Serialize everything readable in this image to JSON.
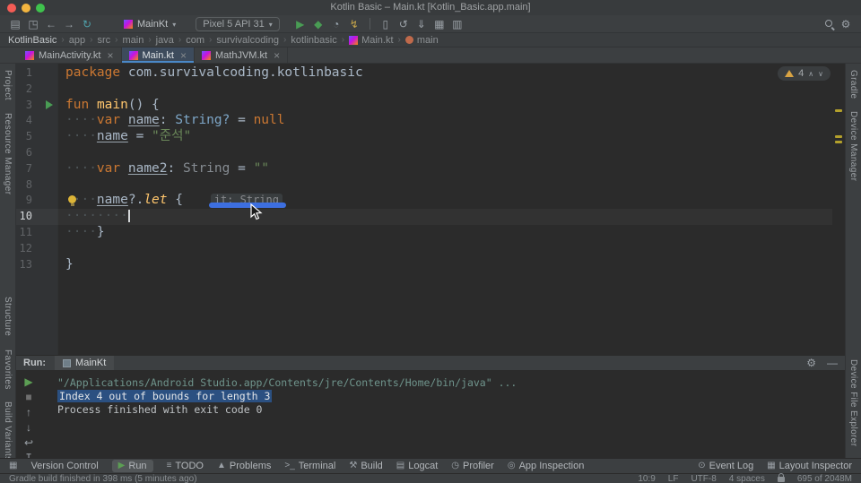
{
  "window": {
    "title": "Kotlin Basic – Main.kt [Kotlin_Basic.app.main]"
  },
  "toolbar": {
    "left_icons": [
      {
        "name": "save-all-icon",
        "glyph": "▤"
      },
      {
        "name": "open-icon",
        "glyph": "◳"
      },
      {
        "name": "back-icon",
        "glyph": "←"
      },
      {
        "name": "forward-icon",
        "glyph": "→"
      },
      {
        "name": "refresh-icon",
        "glyph": "↻",
        "color": "#4e9fa8"
      }
    ],
    "run_config": {
      "label": "MainKt"
    },
    "device": {
      "label": "Pixel 5 API 31"
    },
    "action_icons": [
      {
        "name": "run-icon",
        "glyph": "▶",
        "color": "#499c54"
      },
      {
        "name": "debug-icon",
        "glyph": "◆",
        "color": "#499c54"
      },
      {
        "name": "profile-icon",
        "glyph": "◔",
        "color": "#9aa7b0"
      },
      {
        "name": "apply-changes-icon",
        "glyph": "↯",
        "color": "#c4a44a"
      },
      {
        "sep": true
      },
      {
        "name": "device-manager-icon",
        "glyph": "▯"
      },
      {
        "name": "sync-project-icon",
        "glyph": "↺"
      },
      {
        "name": "sdk-manager-icon",
        "glyph": "⇓"
      },
      {
        "name": "layout-inspector-icon",
        "glyph": "▦"
      },
      {
        "name": "logcat-icon",
        "glyph": "▥"
      }
    ],
    "right_icons": [
      {
        "name": "search-icon",
        "css": "search"
      },
      {
        "name": "settings-gear-icon",
        "glyph": "⚙"
      }
    ]
  },
  "breadcrumb": {
    "separator": "›",
    "items": [
      {
        "label": "KotlinBasic"
      },
      {
        "label": "app"
      },
      {
        "label": "src"
      },
      {
        "label": "main"
      },
      {
        "label": "java"
      },
      {
        "label": "com"
      },
      {
        "label": "survivalcoding"
      },
      {
        "label": "kotlinbasic"
      },
      {
        "label": "Main.kt",
        "icon": "kotlin"
      },
      {
        "label": "main",
        "icon": "function"
      }
    ]
  },
  "tabs": [
    {
      "label": "MainActivity.kt",
      "active": false
    },
    {
      "label": "Main.kt",
      "active": true
    },
    {
      "label": "MathJVM.kt",
      "active": false
    }
  ],
  "left_strip": {
    "top": [
      "Project",
      "Resource Manager"
    ],
    "middle": [
      "Structure",
      "Favorites"
    ],
    "bottom": [
      "Build Variants"
    ]
  },
  "right_strip": {
    "top": [
      "Gradle",
      "Device Manager"
    ],
    "bottom": [
      "Device File Explorer"
    ]
  },
  "editor": {
    "warnings": "4",
    "lines": [
      {
        "num": "1",
        "tokens": [
          {
            "t": "package",
            "c": "kw"
          },
          {
            "t": " com.survivalcoding.kotlinbasic",
            "c": "pl"
          }
        ]
      },
      {
        "num": "2",
        "tokens": []
      },
      {
        "num": "3",
        "gutter": "run",
        "tokens": [
          {
            "t": "fun",
            "c": "kw"
          },
          {
            "t": " ",
            "c": "pl"
          },
          {
            "t": "main",
            "c": "fn"
          },
          {
            "t": "() {",
            "c": "pl"
          }
        ]
      },
      {
        "num": "4",
        "tokens": [
          {
            "t": "····",
            "c": "ws"
          },
          {
            "t": "var",
            "c": "kw"
          },
          {
            "t": " ",
            "c": "pl"
          },
          {
            "t": "name",
            "c": "var"
          },
          {
            "t": ": ",
            "c": "pl"
          },
          {
            "t": "String?",
            "c": "type"
          },
          {
            "t": " = ",
            "c": "pl"
          },
          {
            "t": "null",
            "c": "kw"
          }
        ]
      },
      {
        "num": "5",
        "tokens": [
          {
            "t": "····",
            "c": "ws"
          },
          {
            "t": "name",
            "c": "var"
          },
          {
            "t": " = ",
            "c": "pl"
          },
          {
            "t": "\"준석\"",
            "c": "str"
          }
        ]
      },
      {
        "num": "6",
        "tokens": []
      },
      {
        "num": "7",
        "tokens": [
          {
            "t": "····",
            "c": "ws"
          },
          {
            "t": "var",
            "c": "kw"
          },
          {
            "t": " ",
            "c": "pl"
          },
          {
            "t": "name2",
            "c": "var"
          },
          {
            "t": ": ",
            "c": "pl"
          },
          {
            "t": "String",
            "c": "type2"
          },
          {
            "t": " = ",
            "c": "pl"
          },
          {
            "t": "\"\"",
            "c": "str"
          }
        ]
      },
      {
        "num": "8",
        "tokens": []
      },
      {
        "num": "9",
        "gutter": "bulb",
        "tokens": [
          {
            "t": "····",
            "c": "ws"
          },
          {
            "t": "name",
            "c": "var"
          },
          {
            "t": "?.",
            "c": "pl"
          },
          {
            "t": "let",
            "c": "fni"
          },
          {
            "t": " { ",
            "c": "pl"
          },
          {
            "t": "it: String",
            "c": "hint",
            "bar": true
          }
        ]
      },
      {
        "num": "10",
        "current": true,
        "tokens": [
          {
            "t": "········",
            "c": "ws"
          },
          {
            "t": "",
            "c": "caret"
          }
        ]
      },
      {
        "num": "11",
        "tokens": [
          {
            "t": "····",
            "c": "ws"
          },
          {
            "t": "}",
            "c": "pl"
          }
        ]
      },
      {
        "num": "12",
        "tokens": []
      },
      {
        "num": "13",
        "tokens": [
          {
            "t": "}",
            "c": "pl"
          }
        ]
      }
    ]
  },
  "run_panel": {
    "label": "Run:",
    "tab_label": "MainKt",
    "header_icons": [
      {
        "name": "console-settings-gear-icon",
        "glyph": "⚙"
      },
      {
        "name": "minimize-icon",
        "glyph": "—"
      }
    ],
    "tools": [
      {
        "name": "rerun-icon",
        "glyph": "▶",
        "color": "#5c9e54"
      },
      {
        "name": "stop-icon",
        "glyph": "■",
        "color": "#6f6f6f"
      },
      {
        "name": "scroll-up-icon",
        "glyph": "↑"
      },
      {
        "name": "scroll-down-icon",
        "glyph": "↓"
      },
      {
        "name": "soft-wrap-icon",
        "glyph": "↩"
      },
      {
        "name": "scroll-to-end-icon",
        "glyph": "↧"
      }
    ],
    "output": [
      {
        "text": "\"/Applications/Android Studio.app/Contents/jre/Contents/Home/bin/java\" ...",
        "c": "cmd"
      },
      {
        "text": "Index 4 out of bounds for length 3",
        "c": "sel"
      },
      {
        "text": "Process finished with exit code 0",
        "c": "pl"
      }
    ]
  },
  "bottom_bar": {
    "left": [
      {
        "name": "tool-window-switcher-icon",
        "label": "",
        "glyph": "▦"
      },
      {
        "label": "Version Control"
      },
      {
        "label": "Run",
        "glyph": "▶",
        "color": "#5c9e54",
        "active": true
      },
      {
        "label": "TODO",
        "glyph": "≡"
      },
      {
        "label": "Problems",
        "glyph": "▲"
      },
      {
        "label": "Terminal",
        "glyph": ">_"
      },
      {
        "label": "Build",
        "glyph": "⚒"
      },
      {
        "label": "Logcat",
        "glyph": "▤"
      },
      {
        "label": "Profiler",
        "glyph": "◷"
      },
      {
        "label": "App Inspection",
        "glyph": "◎"
      }
    ],
    "right": [
      {
        "label": "Event Log",
        "glyph": "⊙"
      },
      {
        "label": "Layout Inspector",
        "glyph": "▦"
      }
    ]
  },
  "status_bar": {
    "left": "Gradle build finished in 398 ms (5 minutes ago)",
    "items": [
      {
        "name": "caret-position",
        "label": "10:9"
      },
      {
        "name": "line-separator",
        "label": "LF"
      },
      {
        "name": "file-encoding",
        "label": "UTF-8"
      },
      {
        "name": "indent-config",
        "label": "4 spaces"
      }
    ],
    "memory": "695 of 2048M"
  }
}
